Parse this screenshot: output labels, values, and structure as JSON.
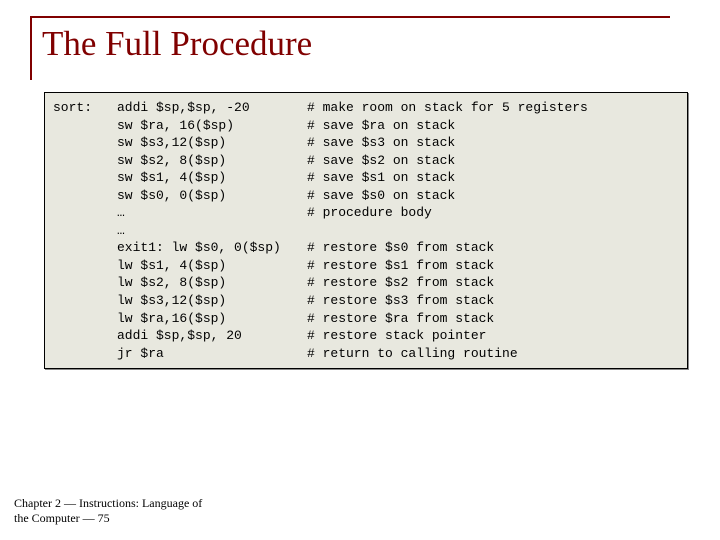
{
  "title": "The Full Procedure",
  "code": {
    "rows": [
      {
        "label": "sort:",
        "instr": "addi $sp,$sp, -20",
        "comment": "# make room on stack for 5 registers"
      },
      {
        "label": "",
        "instr": "sw $ra, 16($sp)",
        "comment": "# save $ra on stack"
      },
      {
        "label": "",
        "instr": "sw $s3,12($sp)",
        "comment": "# save $s3 on stack"
      },
      {
        "label": "",
        "instr": "sw $s2, 8($sp)",
        "comment": "# save $s2 on stack"
      },
      {
        "label": "",
        "instr": "sw $s1, 4($sp)",
        "comment": "# save $s1 on stack"
      },
      {
        "label": "",
        "instr": "sw $s0, 0($sp)",
        "comment": "# save $s0 on stack"
      },
      {
        "label": "",
        "instr": "…",
        "comment": "# procedure body"
      },
      {
        "label": "",
        "instr": "…",
        "comment": ""
      },
      {
        "label": "",
        "instr": "exit1: lw $s0, 0($sp)",
        "comment": "# restore $s0 from stack"
      },
      {
        "label": "",
        "instr": "lw $s1, 4($sp)",
        "comment": "# restore $s1 from stack"
      },
      {
        "label": "",
        "instr": "lw $s2, 8($sp)",
        "comment": "# restore $s2 from stack"
      },
      {
        "label": "",
        "instr": "lw $s3,12($sp)",
        "comment": "# restore $s3 from stack"
      },
      {
        "label": "",
        "instr": "lw $ra,16($sp)",
        "comment": "# restore $ra from stack"
      },
      {
        "label": "",
        "instr": "addi $sp,$sp, 20",
        "comment": "# restore stack pointer"
      },
      {
        "label": "",
        "instr": "jr $ra",
        "comment": "# return to calling routine"
      }
    ]
  },
  "footer": "Chapter 2 — Instructions: Language of the Computer — 75"
}
